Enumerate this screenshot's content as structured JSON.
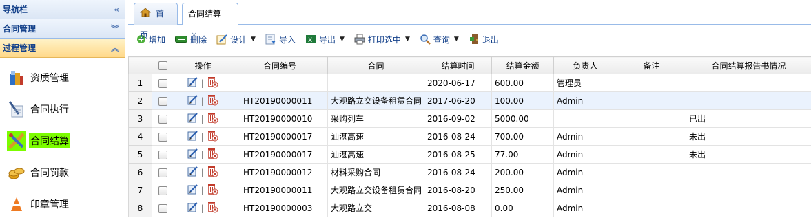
{
  "sidebar": {
    "nav_title": "导航栏",
    "contract_mgmt": "合同管理",
    "process_mgmt": "过程管理",
    "items": [
      {
        "label": "资质管理",
        "icon": "books-icon"
      },
      {
        "label": "合同执行",
        "icon": "pen-paper-icon"
      },
      {
        "label": "合同结算",
        "icon": "pencil-ruler-icon"
      },
      {
        "label": "合同罚款",
        "icon": "coins-icon"
      },
      {
        "label": "印章管理",
        "icon": "cone-icon"
      }
    ]
  },
  "tabs": {
    "home": "首页",
    "current": "合同结算",
    "close": "×"
  },
  "toolbar": {
    "add": "增加",
    "delete": "删除",
    "design": "设计",
    "import": "导入",
    "export": "导出",
    "print": "打印选中",
    "query": "查询",
    "exit": "退出"
  },
  "grid": {
    "headers": {
      "ops": "操作",
      "code": "合同编号",
      "contract": "合同",
      "time": "结算时间",
      "amount": "结算金额",
      "owner": "负责人",
      "note": "备注",
      "report": "合同结算报告书情况"
    },
    "rows": [
      {
        "n": "1",
        "code": "",
        "contract": "",
        "time": "2020-06-17",
        "amount": "600.00",
        "owner": "管理员",
        "note": "",
        "report": ""
      },
      {
        "n": "2",
        "code": "HT20190000011",
        "contract": "大观路立交设备租赁合同",
        "time": "2017-06-20",
        "amount": "100.00",
        "owner": "Admin",
        "note": "",
        "report": ""
      },
      {
        "n": "3",
        "code": "HT20190000010",
        "contract": "采购列车",
        "time": "2016-09-02",
        "amount": "5000.00",
        "owner": "",
        "note": "",
        "report": "已出"
      },
      {
        "n": "4",
        "code": "HT20190000017",
        "contract": "汕湛高速",
        "time": "2016-08-24",
        "amount": "700.00",
        "owner": "Admin",
        "note": "",
        "report": "未出"
      },
      {
        "n": "5",
        "code": "HT20190000017",
        "contract": "汕湛高速",
        "time": "2016-08-25",
        "amount": "77.00",
        "owner": "Admin",
        "note": "",
        "report": "未出"
      },
      {
        "n": "6",
        "code": "HT20190000012",
        "contract": "材料采购合同",
        "time": "2016-08-24",
        "amount": "200.00",
        "owner": "Admin",
        "note": "",
        "report": ""
      },
      {
        "n": "7",
        "code": "HT20190000011",
        "contract": "大观路立交设备租赁合同",
        "time": "2016-08-20",
        "amount": "250.00",
        "owner": "Admin",
        "note": "",
        "report": ""
      },
      {
        "n": "8",
        "code": "HT20190000003",
        "contract": "大观路立交",
        "time": "2016-08-08",
        "amount": "0.00",
        "owner": "Admin",
        "note": "",
        "report": ""
      }
    ]
  },
  "colors": {
    "accent": "#15428b",
    "selected_item_bg": "#7cfc00",
    "active_header": "#ffd98a"
  }
}
